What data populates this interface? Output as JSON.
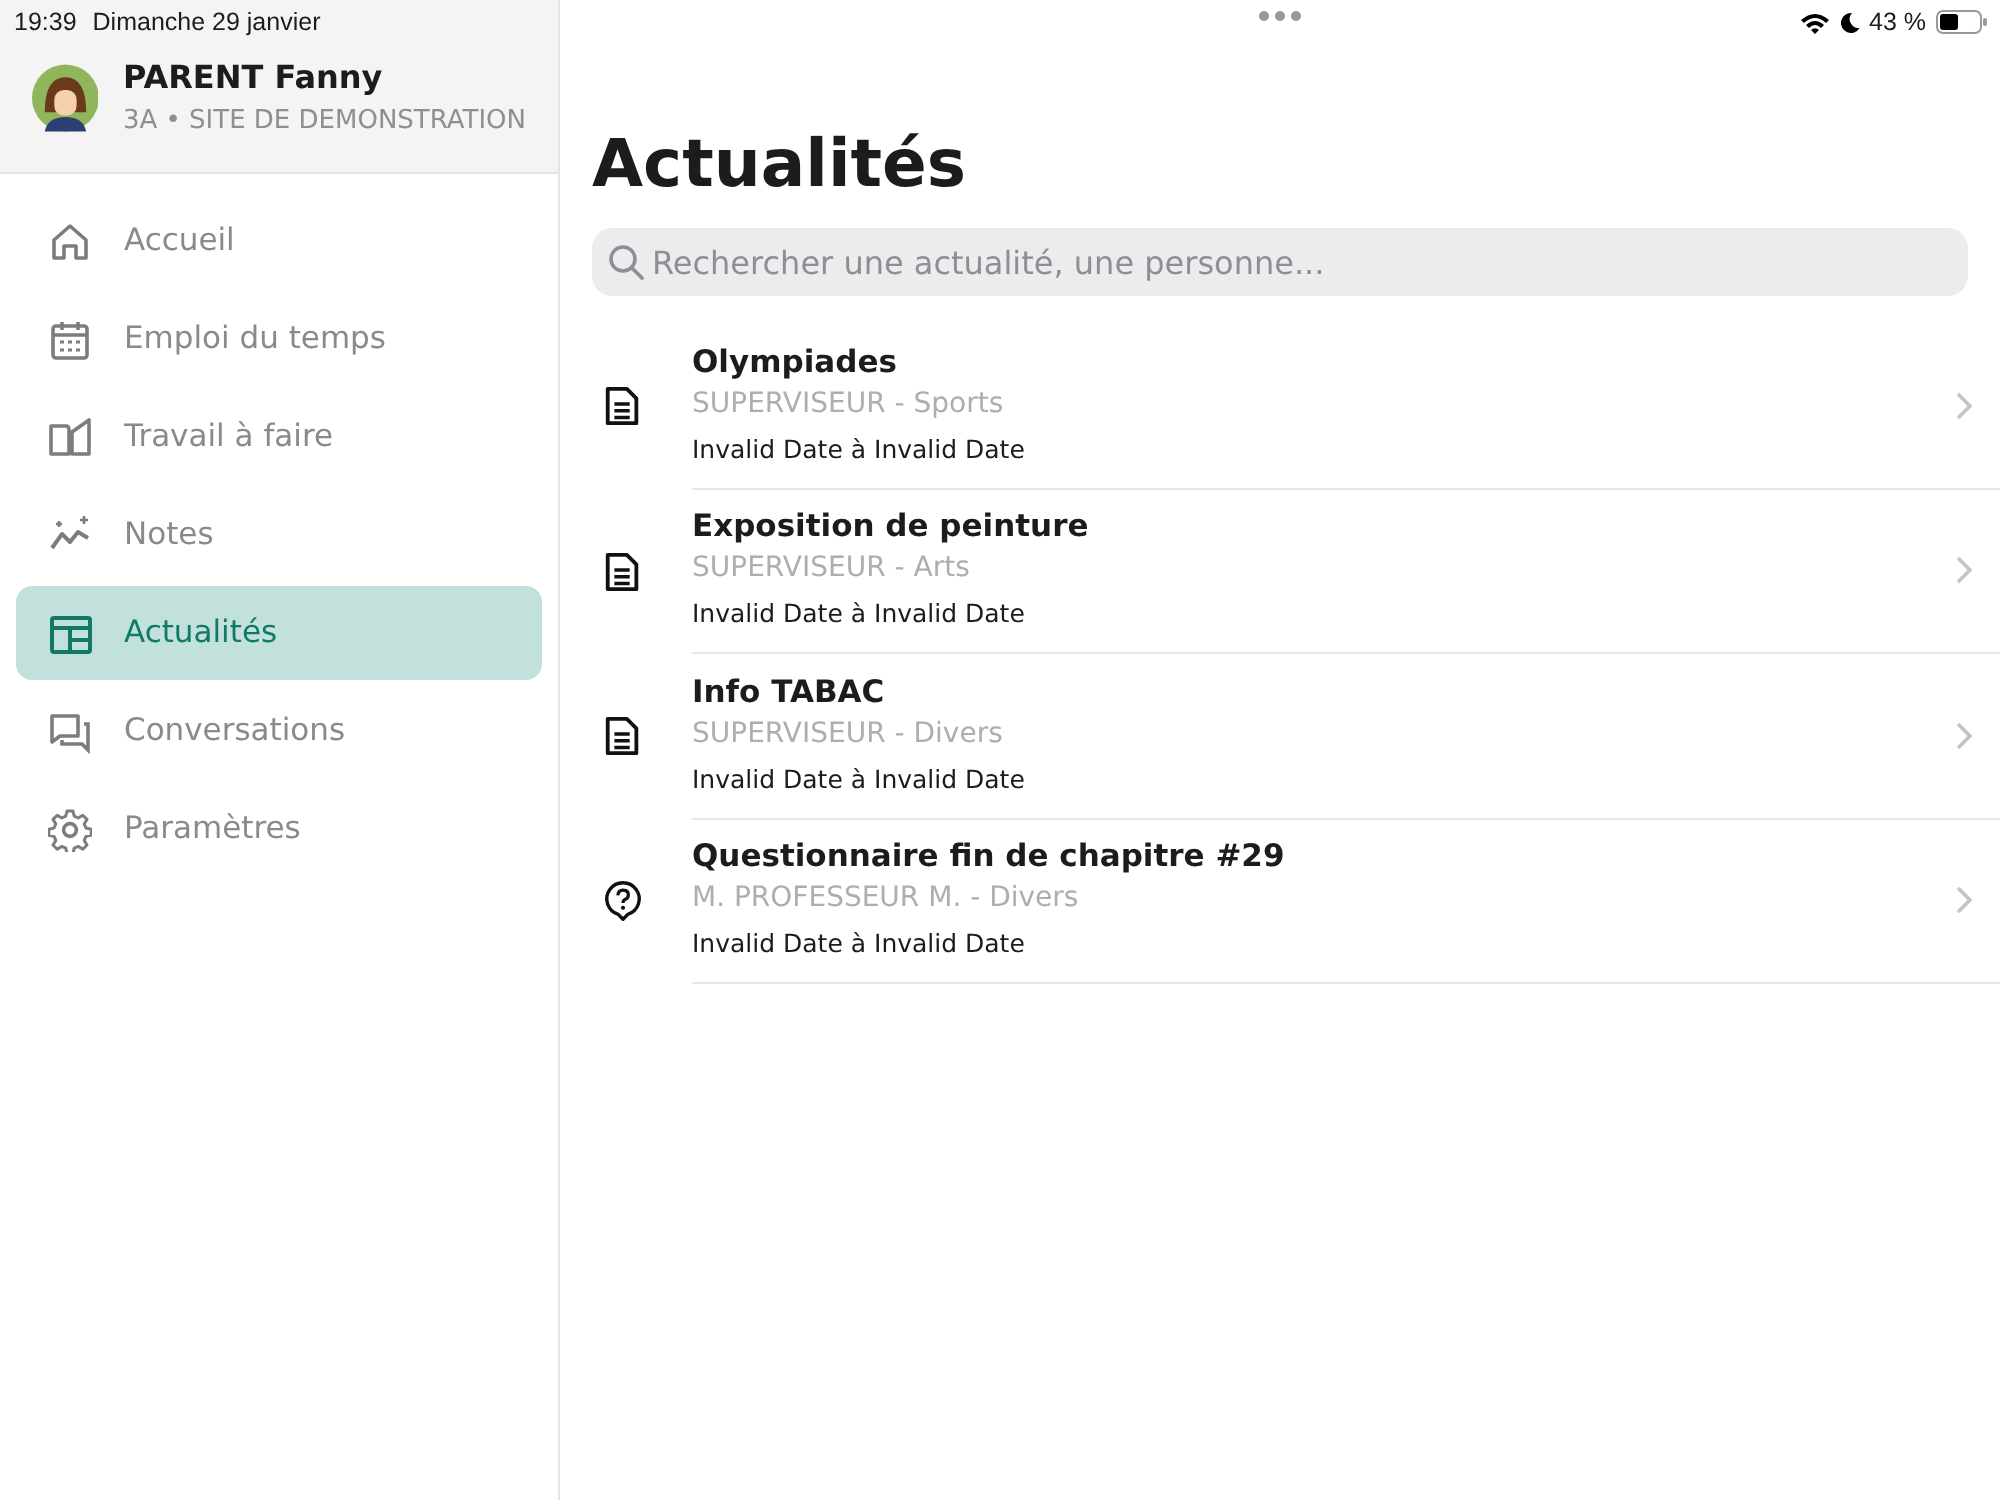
{
  "status_bar": {
    "time": "19:39",
    "date": "Dimanche 29 janvier",
    "battery": "43 %"
  },
  "profile": {
    "name": "PARENT Fanny",
    "subtitle": "3A • SITE DE DEMONSTRATION"
  },
  "sidebar": {
    "items": [
      {
        "label": "Accueil",
        "selected": false
      },
      {
        "label": "Emploi du temps",
        "selected": false
      },
      {
        "label": "Travail à faire",
        "selected": false
      },
      {
        "label": "Notes",
        "selected": false
      },
      {
        "label": "Actualités",
        "selected": true
      },
      {
        "label": "Conversations",
        "selected": false
      },
      {
        "label": "Paramètres",
        "selected": false
      }
    ]
  },
  "main": {
    "title": "Actualités",
    "search": {
      "placeholder": "Rechercher une actualité, une personne..."
    },
    "items": [
      {
        "kind": "article",
        "title": "Olympiades",
        "author": "SUPERVISEUR - Sports",
        "dates": "Invalid Date à Invalid Date"
      },
      {
        "kind": "article",
        "title": "Exposition de peinture",
        "author": "SUPERVISEUR - Arts",
        "dates": "Invalid Date à Invalid Date"
      },
      {
        "kind": "article",
        "title": "Info TABAC",
        "author": "SUPERVISEUR - Divers",
        "dates": "Invalid Date à Invalid Date"
      },
      {
        "kind": "questionnaire",
        "title": "Questionnaire fin de chapitre #29",
        "author": "M. PROFESSEUR M. - Divers",
        "dates": "Invalid Date à Invalid Date"
      }
    ]
  }
}
